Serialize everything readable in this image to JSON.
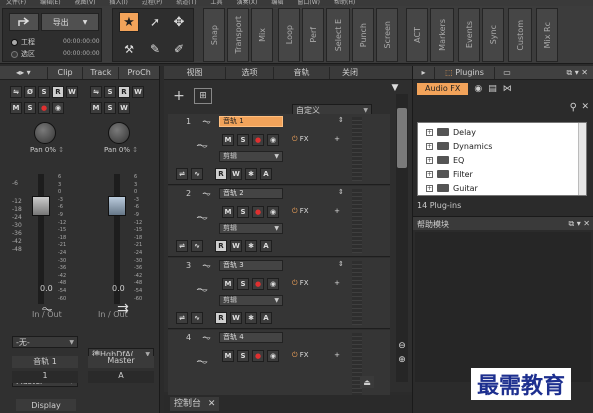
{
  "menubar": {
    "items": [
      "文件(F)",
      "编辑(E)",
      "视图(V)",
      "插入(I)",
      "过程(P)",
      "轨道(T)",
      "工具",
      "演奏(X)",
      "编辑",
      "窗口(W)",
      "帮助(H)"
    ]
  },
  "toolbar": {
    "export_label": "导出",
    "mode_1": "工程",
    "mode_2": "选区",
    "time_1": "00:00:00:00",
    "time_2": "00:00:00:00",
    "modules": [
      "Snap",
      "Transport",
      "Mix",
      "Loop",
      "Perf",
      "Select E",
      "Punch",
      "Screen",
      "ACT",
      "Markers",
      "Events",
      "Sync",
      "Custom",
      "Mix Rc"
    ]
  },
  "inspector": {
    "tabs": [
      "Clip",
      "Track",
      "ProCh"
    ],
    "pan_label": "Pan",
    "pan_value": "0%",
    "db_ticks": [
      "6",
      "3",
      "0",
      "-3",
      "-6",
      "-9",
      "-12",
      "-15",
      "-18",
      "-21",
      "-24",
      "-30",
      "-36",
      "-42",
      "-48",
      "-54",
      "-60"
    ],
    "db_ticks_left": [
      "-6",
      "-12",
      "-18",
      "-24",
      "-30",
      "-36",
      "-42",
      "-48",
      "-54",
      "-60"
    ],
    "vol_value_1": "0.0",
    "vol_value_2": "0.0",
    "io_label": "In / Out",
    "input_1": "-无-",
    "input_2": "德HghDfA(",
    "output_1": "Master",
    "output_2": "Master",
    "strip_name_1": "音轨 1",
    "strip_name_2": "Master",
    "strip_num_1": "1",
    "strip_num_2": "A",
    "display_tab": "Display"
  },
  "trackview": {
    "menus": [
      "视图",
      "选项",
      "音轨",
      "关闭"
    ],
    "preset": "自定义",
    "tracks": [
      {
        "num": "1",
        "name": "音轨 1",
        "edit": "剪辑",
        "fx": "FX"
      },
      {
        "num": "2",
        "name": "音轨 2",
        "edit": "剪辑",
        "fx": "FX"
      },
      {
        "num": "3",
        "name": "音轨 3",
        "edit": "剪辑",
        "fx": "FX"
      },
      {
        "num": "4",
        "name": "音轨 4",
        "edit": "",
        "fx": "FX"
      }
    ],
    "btn_m": "M",
    "btn_s": "S",
    "btn_r": "R",
    "btn_w": "W",
    "btn_a": "A",
    "btn_star": "✱"
  },
  "bottom": {
    "console_tab": "控制台"
  },
  "browser": {
    "tab_plugins": "Plugins",
    "tab_audiofx": "Audio FX",
    "folders": [
      "Delay",
      "Dynamics",
      "EQ",
      "Filter",
      "Guitar"
    ],
    "count": "14 Plug-ins",
    "help_title": "帮助模块"
  },
  "watermark": "最需教育",
  "colors": {
    "accent": "#f2a35a",
    "record": "#e03030",
    "panel": "#353535"
  }
}
